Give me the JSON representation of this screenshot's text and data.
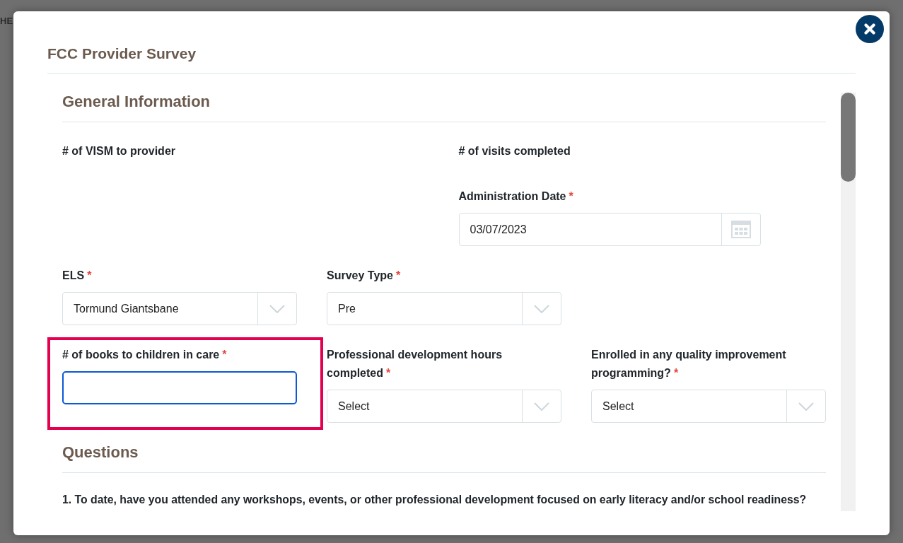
{
  "background": {
    "heading_fragment": "HE"
  },
  "dialog": {
    "title": "FCC Provider Survey",
    "required_mark": "*",
    "sections": [
      {
        "heading": "General Information",
        "rows": [
          {
            "kind": "halves",
            "cells": [
              {
                "fields": [
                  {
                    "kind": "label_only",
                    "label": "# of VISM to provider",
                    "required": false,
                    "highlighted": false
                  }
                ]
              },
              {
                "fields": [
                  {
                    "kind": "label_only",
                    "label": "# of visits completed",
                    "required": false,
                    "highlighted": false
                  },
                  {
                    "kind": "date",
                    "label": "Administration Date",
                    "required": true,
                    "highlighted": false,
                    "focused": false,
                    "value": "03/07/2023"
                  }
                ]
              }
            ]
          },
          {
            "kind": "thirds",
            "cells": [
              {
                "fields": [
                  {
                    "kind": "select",
                    "label": "ELS",
                    "required": true,
                    "highlighted": false,
                    "focused": false,
                    "value": "Tormund Giantsbane"
                  }
                ]
              },
              {
                "fields": [
                  {
                    "kind": "select",
                    "label": "Survey Type",
                    "required": true,
                    "highlighted": false,
                    "focused": false,
                    "value": "Pre"
                  }
                ]
              }
            ]
          },
          {
            "kind": "thirds",
            "cells": [
              {
                "fields": [
                  {
                    "kind": "text",
                    "label": "# of books to children in care",
                    "required": true,
                    "highlighted": true,
                    "focused": true
                  }
                ]
              },
              {
                "fields": [
                  {
                    "kind": "select",
                    "label": "Professional development hours completed",
                    "required": true,
                    "highlighted": false,
                    "focused": false,
                    "value": "Select"
                  }
                ]
              },
              {
                "fields": [
                  {
                    "kind": "select",
                    "label": "Enrolled in any quality improvement programming?",
                    "required": true,
                    "highlighted": false,
                    "focused": false,
                    "value": "Select"
                  }
                ]
              }
            ]
          }
        ]
      },
      {
        "heading": "Questions",
        "questions": [
          {
            "text": "1. To date, have you attended any workshops, events, or other professional development focused on early literacy and/or school readiness?"
          }
        ]
      }
    ]
  }
}
